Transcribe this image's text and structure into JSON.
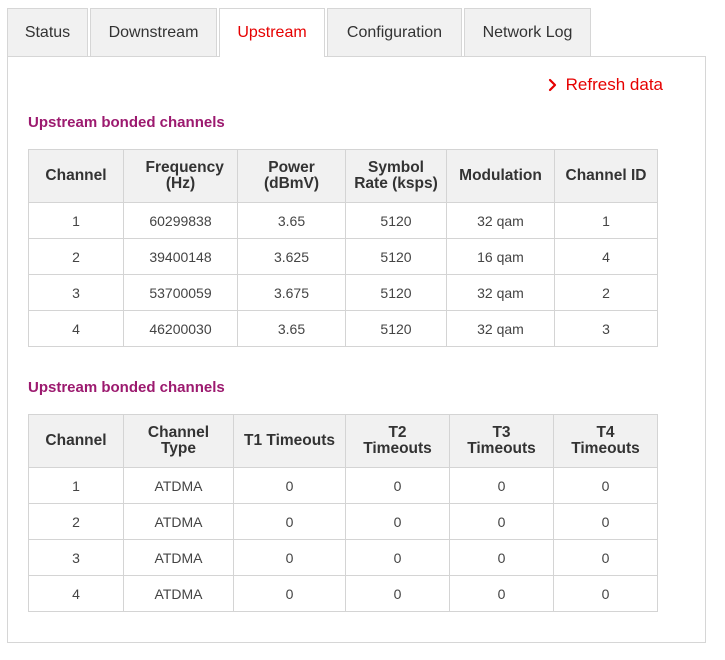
{
  "tabs": [
    {
      "label": "Status"
    },
    {
      "label": "Downstream"
    },
    {
      "label": "Upstream"
    },
    {
      "label": "Configuration"
    },
    {
      "label": "Network Log"
    }
  ],
  "active_tab": "Upstream",
  "refresh_label": "Refresh data",
  "accent_color": "#e60000",
  "heading_color": "#9c1a6f",
  "section1": {
    "title": "Upstream bonded channels",
    "headers": [
      "Channel",
      "Frequency (Hz)",
      "Power (dBmV)",
      "Symbol Rate (ksps)",
      "Modulation",
      "Channel ID"
    ],
    "rows": [
      [
        "1",
        "60299838",
        "3.65",
        "5120",
        "32 qam",
        "1"
      ],
      [
        "2",
        "39400148",
        "3.625",
        "5120",
        "16 qam",
        "4"
      ],
      [
        "3",
        "53700059",
        "3.675",
        "5120",
        "32 qam",
        "2"
      ],
      [
        "4",
        "46200030",
        "3.65",
        "5120",
        "32 qam",
        "3"
      ]
    ]
  },
  "section2": {
    "title": "Upstream bonded channels",
    "headers": [
      "Channel",
      "Channel Type",
      "T1 Timeouts",
      "T2 Timeouts",
      "T3 Timeouts",
      "T4 Timeouts"
    ],
    "rows": [
      [
        "1",
        "ATDMA",
        "0",
        "0",
        "0",
        "0"
      ],
      [
        "2",
        "ATDMA",
        "0",
        "0",
        "0",
        "0"
      ],
      [
        "3",
        "ATDMA",
        "0",
        "0",
        "0",
        "0"
      ],
      [
        "4",
        "ATDMA",
        "0",
        "0",
        "0",
        "0"
      ]
    ]
  }
}
